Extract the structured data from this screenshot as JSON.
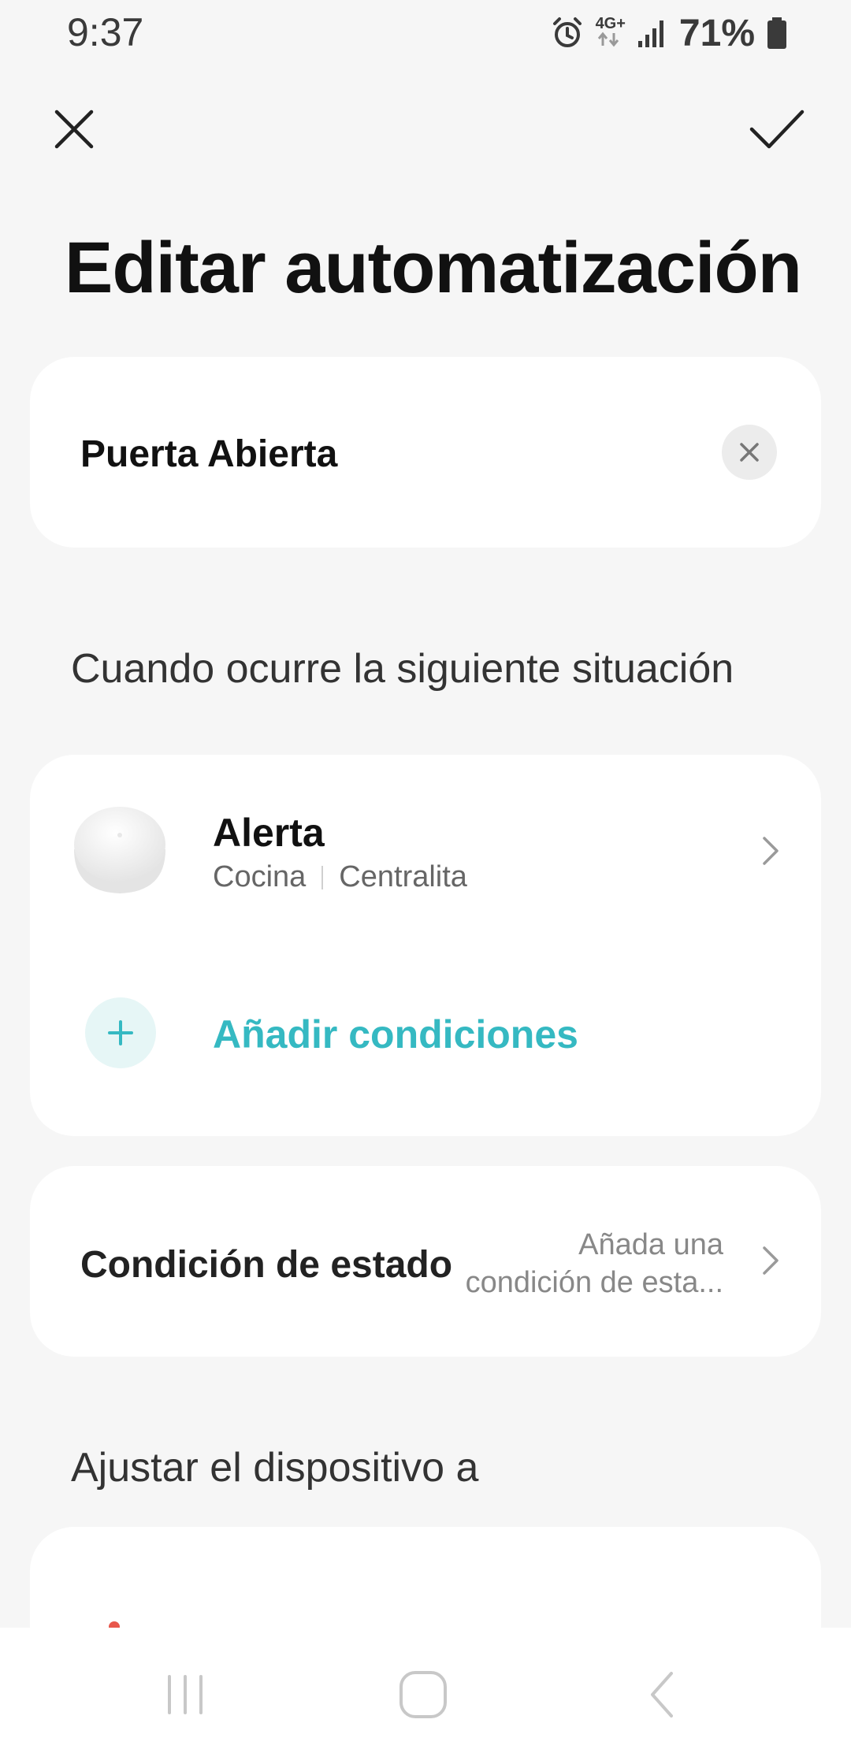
{
  "status_bar": {
    "time": "9:37",
    "network": "4G+",
    "battery": "71%"
  },
  "header": {
    "title": "Editar automatización"
  },
  "name_card": {
    "value": "Puerta Abierta"
  },
  "trigger_section": {
    "heading": "Cuando ocurre la siguiente situación",
    "trigger": {
      "title": "Alerta",
      "room": "Cocina",
      "device": "Centralita"
    },
    "add_label": "Añadir condiciones"
  },
  "condition_card": {
    "label": "Condición de estado",
    "value_line1": "Añada una",
    "value_line2": "condición de esta..."
  },
  "action_section": {
    "heading": "Ajustar el dispositivo a"
  },
  "colors": {
    "accent": "#35b9c2",
    "background": "#f6f6f6",
    "card": "#ffffff"
  }
}
